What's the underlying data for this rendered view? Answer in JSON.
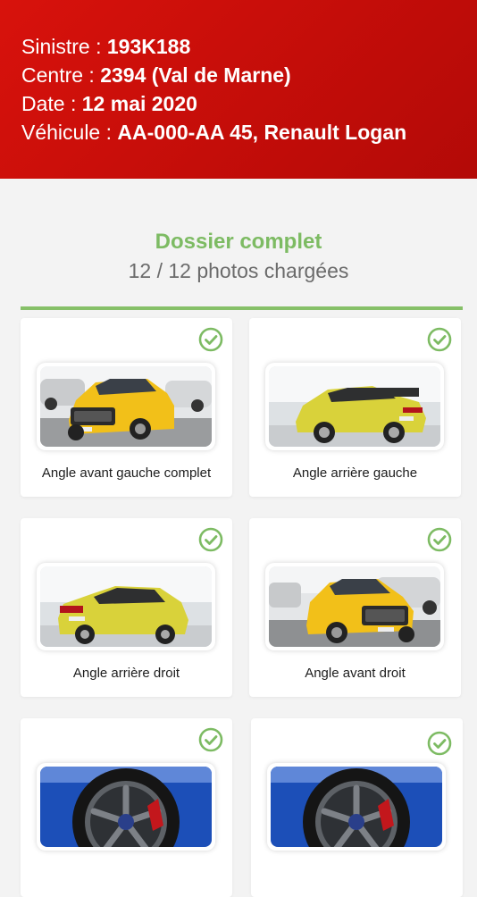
{
  "header": {
    "sinistre_label": "Sinistre : ",
    "sinistre_value": "193K188",
    "centre_label": "Centre : ",
    "centre_value": "2394 (Val de Marne)",
    "date_label": "Date : ",
    "date_value": "12 mai 2020",
    "vehicule_label": "Véhicule : ",
    "vehicule_value": "AA-000-AA 45, Renault Logan"
  },
  "status": {
    "title": "Dossier complet",
    "subtitle": "12 / 12 photos chargées",
    "progress": 1.0
  },
  "photos": [
    {
      "label": "Angle avant gauche complet",
      "icon": "check-circle-icon",
      "image": "suv-front-left"
    },
    {
      "label": "Angle arrière gauche",
      "icon": "check-circle-icon",
      "image": "hatchback-rear-left"
    },
    {
      "label": "Angle arrière droit",
      "icon": "check-circle-icon",
      "image": "hatchback-rear-right"
    },
    {
      "label": "Angle avant droit",
      "icon": "check-circle-icon",
      "image": "suv-front-right"
    },
    {
      "label": "",
      "icon": "check-circle-icon",
      "image": "wheel-closeup"
    },
    {
      "label": "",
      "icon": "check-circle-icon",
      "image": "wheel-closeup"
    }
  ],
  "colors": {
    "header_red": "#d8120c",
    "accent_green": "#7dbb63",
    "car_yellow": "#f2c019",
    "car_lime": "#d9d23a",
    "car_blue": "#1c4fb8"
  }
}
